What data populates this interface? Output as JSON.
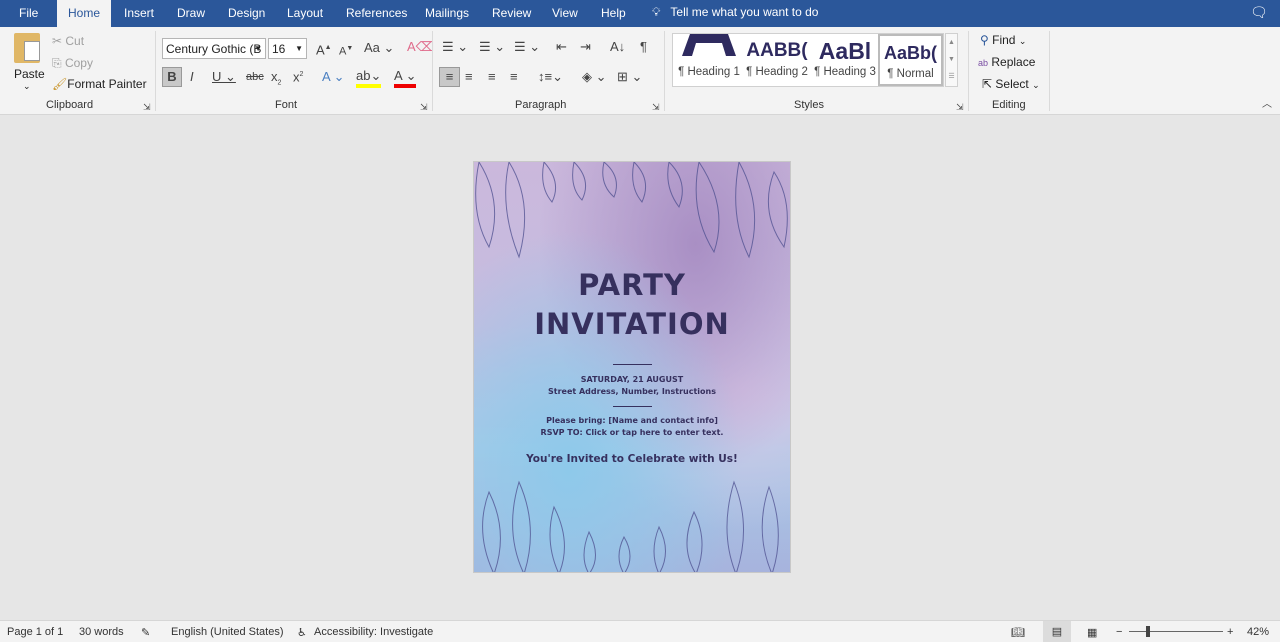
{
  "tabs": [
    "File",
    "Home",
    "Insert",
    "Draw",
    "Design",
    "Layout",
    "References",
    "Mailings",
    "Review",
    "View",
    "Help"
  ],
  "active_tab": "Home",
  "tell_me": "Tell me what you want to do",
  "clipboard": {
    "paste": "Paste",
    "cut": "Cut",
    "copy": "Copy",
    "format_painter": "Format Painter",
    "label": "Clipboard"
  },
  "font": {
    "name": "Century Gothic (B",
    "size": "16",
    "change_case": "Aa",
    "label": "Font"
  },
  "paragraph": {
    "label": "Paragraph"
  },
  "styles": {
    "items": [
      {
        "preview": "",
        "label": "¶ Heading 1"
      },
      {
        "preview": "AABB(",
        "label": "¶ Heading 2"
      },
      {
        "preview": "AaBl",
        "label": "¶ Heading 3"
      },
      {
        "preview": "AaBb(",
        "label": "¶ Normal"
      }
    ],
    "label": "Styles"
  },
  "editing": {
    "find": "Find",
    "replace": "Replace",
    "select": "Select",
    "label": "Editing"
  },
  "document": {
    "title1": "PARTY",
    "title2": "INVITATION",
    "date": "SATURDAY, 21 AUGUST",
    "address": "Street Address, Number, Instructions",
    "bring": "Please bring: [Name and contact info]",
    "rsvp": "RSVP TO: Click or tap here to enter text.",
    "invite": "You're Invited to Celebrate with Us!"
  },
  "status": {
    "page": "Page 1 of 1",
    "words": "30 words",
    "language": "English (United States)",
    "accessibility": "Accessibility: Investigate",
    "zoom": "42%"
  },
  "colors": {
    "brand": "#2b579a",
    "title": "#36305e"
  }
}
